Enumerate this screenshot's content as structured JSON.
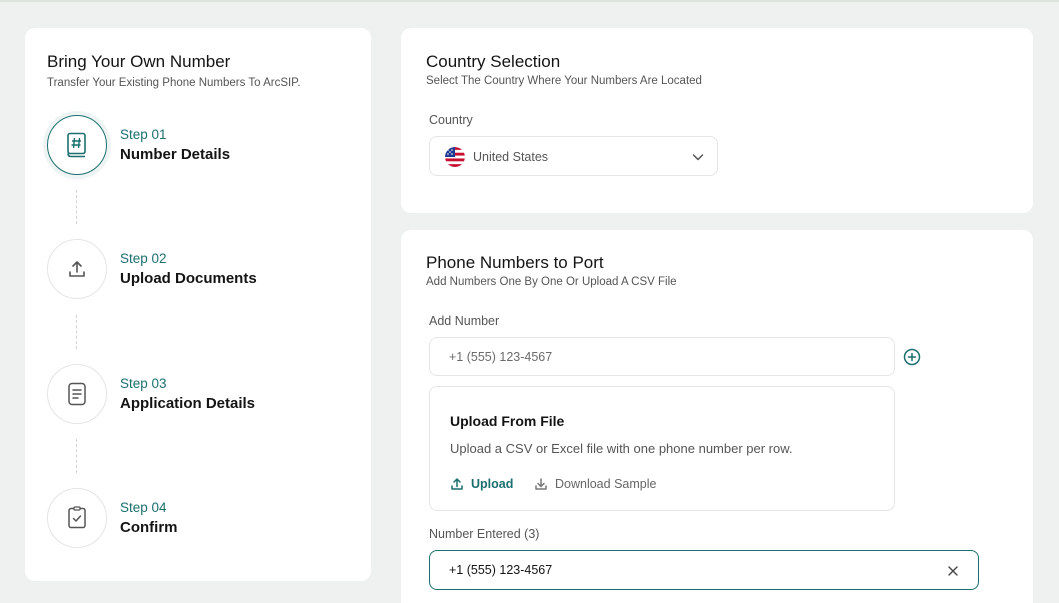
{
  "sidebar": {
    "title": "Bring Your Own Number",
    "subtitle": "Transfer Your Existing Phone Numbers To ArcSIP.",
    "steps": [
      {
        "number": "Step 01",
        "name": "Number Details",
        "icon": "hash-book-icon",
        "active": true
      },
      {
        "number": "Step 02",
        "name": "Upload Documents",
        "icon": "upload-icon",
        "active": false
      },
      {
        "number": "Step 03",
        "name": "Application Details",
        "icon": "document-icon",
        "active": false
      },
      {
        "number": "Step 04",
        "name": "Confirm",
        "icon": "checklist-icon",
        "active": false
      }
    ]
  },
  "country": {
    "title": "Country Selection",
    "subtitle": "Select The Country Where Your Numbers Are Located",
    "label": "Country",
    "selected": "United States",
    "flag_icon": "us-flag-icon"
  },
  "phone": {
    "title": "Phone Numbers to Port",
    "subtitle": "Add Numbers One By One Or Upload A CSV File",
    "add_label": "Add Number",
    "add_placeholder": "+1 (555) 123-4567",
    "upload_title": "Upload From File",
    "upload_desc": "Upload a CSV or Excel file with one phone number per row.",
    "upload_link": "Upload",
    "download_link": "Download Sample",
    "entered_label": "Number Entered (3)",
    "entered_value": "+1 (555) 123-4567"
  },
  "colors": {
    "accent": "#1c6f6f",
    "background": "#eef1ef",
    "panel": "#ffffff"
  }
}
